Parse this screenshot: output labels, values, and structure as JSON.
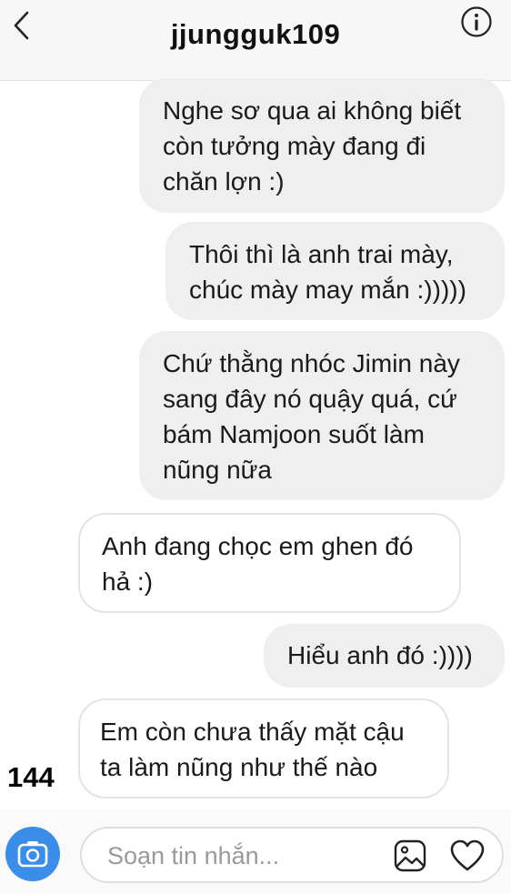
{
  "header": {
    "title": "jjungguk109"
  },
  "messages": [
    {
      "side": "outgoing",
      "text": "Nghe sơ qua ai không biết\ncòn tưởng mày đang đi\nchăn lợn :)"
    },
    {
      "side": "outgoing",
      "text": "Thôi thì là anh trai mày,\nchúc mày may mắn :)))))"
    },
    {
      "side": "outgoing",
      "text": "Chứ thằng nhóc Jimin này\nsang đây nó quậy quá, cứ\nbám Namjoon suốt làm\nnũng nữa"
    },
    {
      "side": "incoming",
      "text": "Anh đang chọc em ghen đó\nhả :)"
    },
    {
      "side": "outgoing",
      "text": "Hiểu anh đó :))))"
    },
    {
      "side": "incoming",
      "text": "Em còn chưa thấy mặt cậu\nta làm nũng như thế nào"
    }
  ],
  "overlay_number": "144",
  "composer": {
    "placeholder": "Soạn tin nhắn..."
  },
  "icons": {
    "back": "chevron-left-icon",
    "info": "info-icon",
    "camera": "camera-icon",
    "gallery": "gallery-icon",
    "heart": "heart-icon"
  },
  "colors": {
    "camera_button": "#3a8eea",
    "outgoing_bubble": "#efefef",
    "incoming_border": "#e4e4e4"
  }
}
